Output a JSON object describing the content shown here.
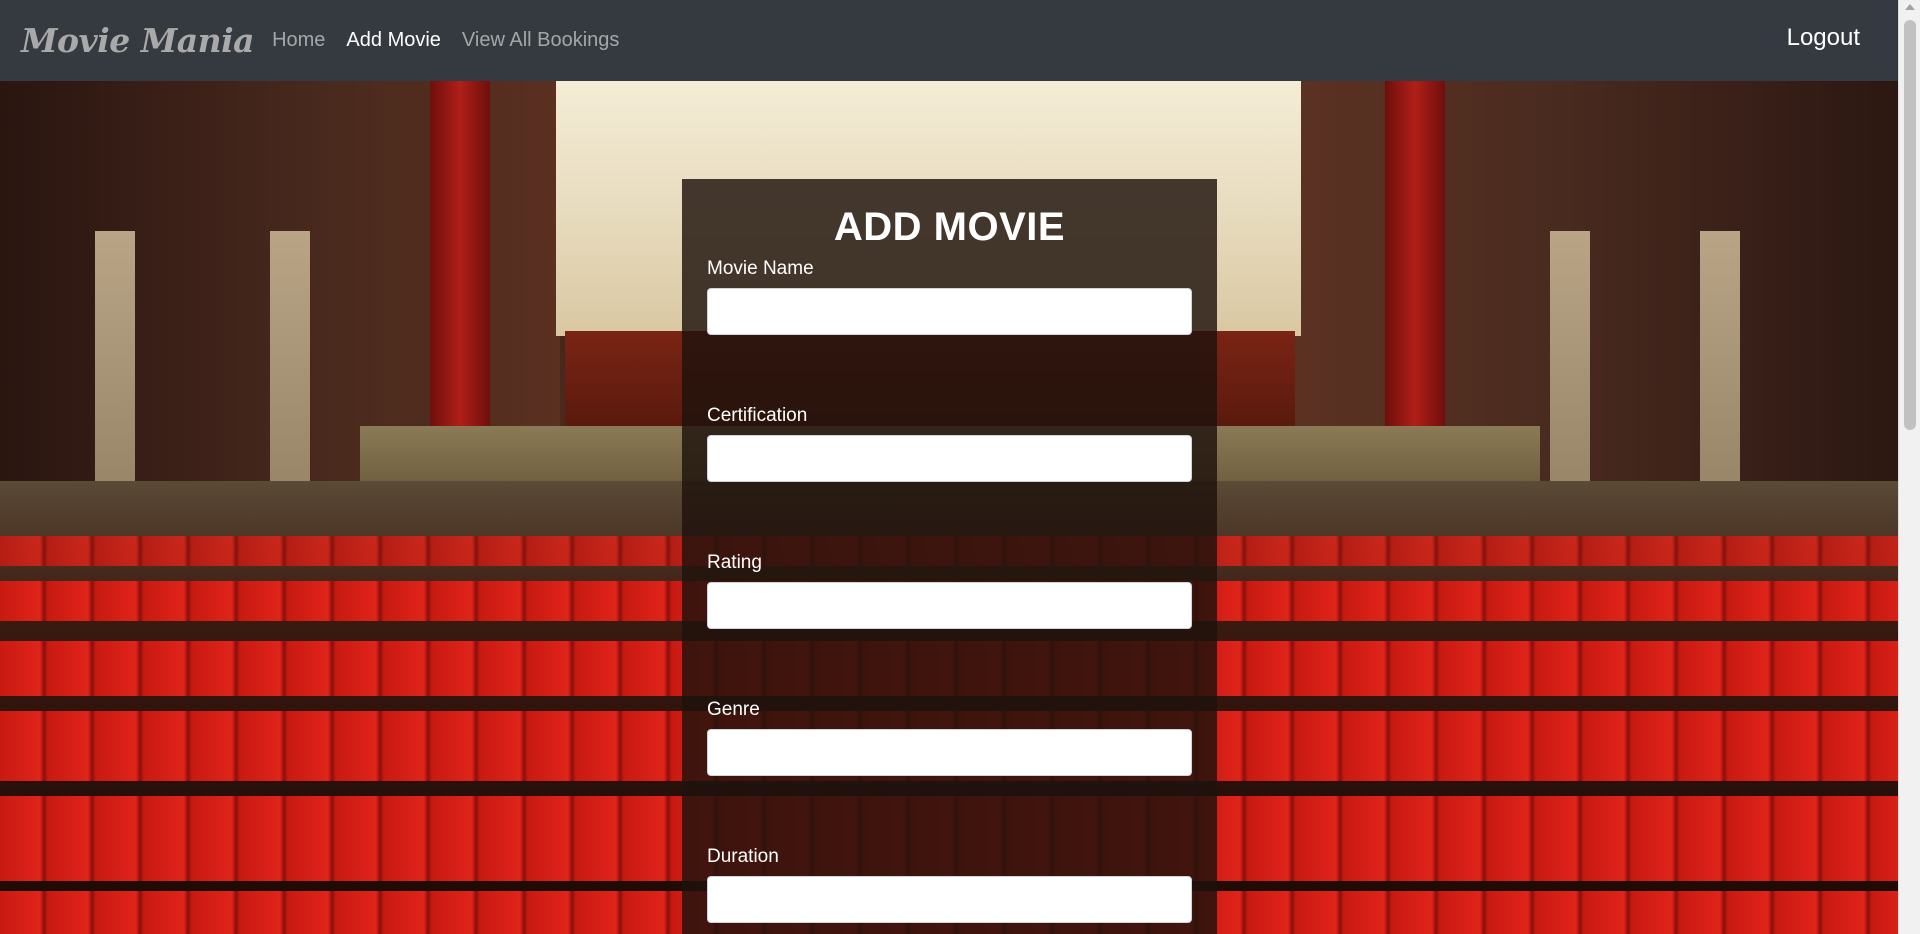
{
  "navbar": {
    "brand": "Movie Mania",
    "links": [
      {
        "label": "Home",
        "active": false
      },
      {
        "label": "Add Movie",
        "active": true
      },
      {
        "label": "View All Bookings",
        "active": false
      }
    ],
    "logout_label": "Logout"
  },
  "form": {
    "title": "ADD MOVIE",
    "fields": [
      {
        "label": "Movie Name",
        "value": "",
        "placeholder": ""
      },
      {
        "label": "Certification",
        "value": "",
        "placeholder": ""
      },
      {
        "label": "Rating",
        "value": "",
        "placeholder": ""
      },
      {
        "label": "Genre",
        "value": "",
        "placeholder": ""
      },
      {
        "label": "Duration",
        "value": "",
        "placeholder": ""
      }
    ]
  },
  "colors": {
    "navbar_bg": "#343a40",
    "nav_active": "#ffffff",
    "nav_inactive": "#8c9196",
    "panel_bg": "rgba(30,18,12,0.82)"
  }
}
